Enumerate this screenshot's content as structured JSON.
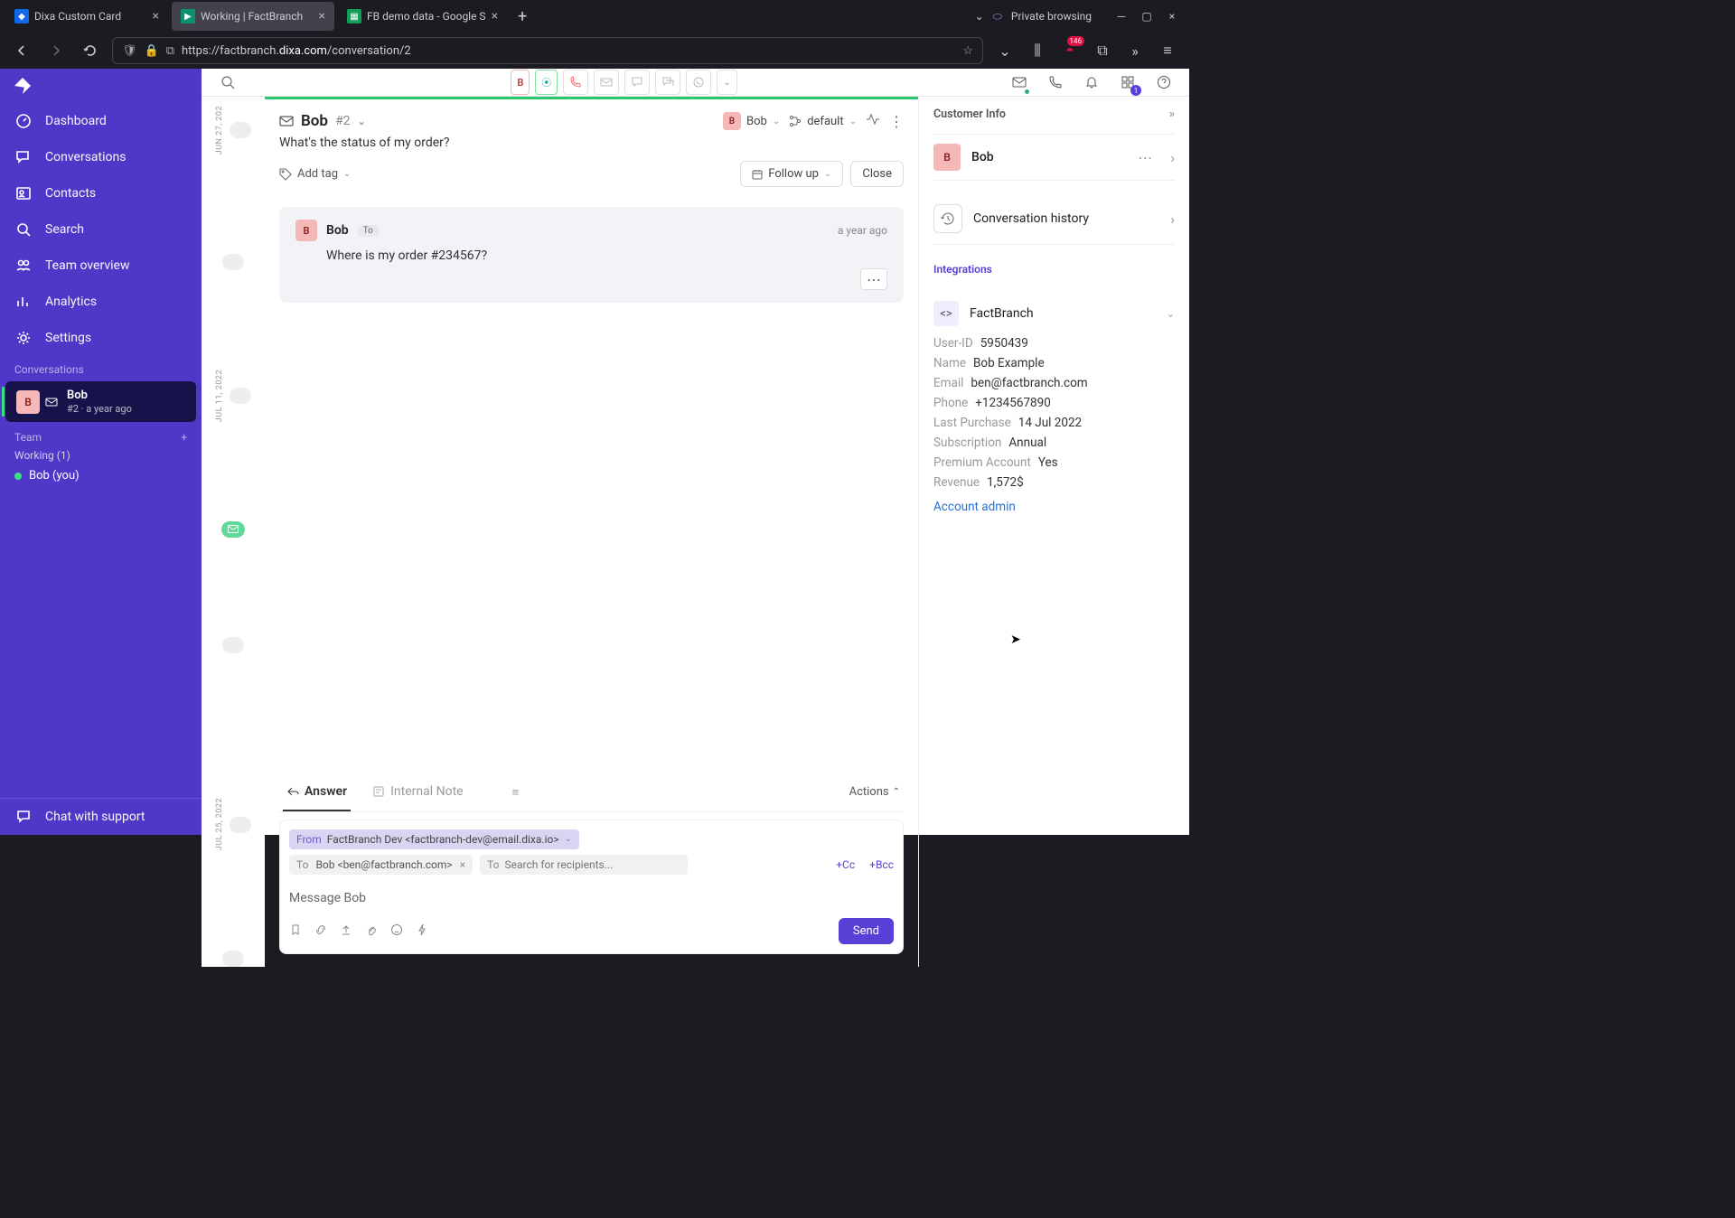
{
  "browser": {
    "tabs": [
      {
        "title": "Dixa Custom Card",
        "active": false
      },
      {
        "title": "Working | FactBranch",
        "active": true
      },
      {
        "title": "FB demo data - Google S",
        "active": false
      }
    ],
    "url_prefix": "https://factbranch.",
    "url_domain": "dixa.com",
    "url_path": "/conversation/2",
    "private_label": "Private browsing",
    "ext_badge": "146"
  },
  "sidebar": {
    "nav": [
      {
        "label": "Dashboard"
      },
      {
        "label": "Conversations"
      },
      {
        "label": "Contacts"
      },
      {
        "label": "Search"
      },
      {
        "label": "Team overview"
      },
      {
        "label": "Analytics"
      },
      {
        "label": "Settings"
      }
    ],
    "conversations_label": "Conversations",
    "conv": {
      "initial": "B",
      "name": "Bob",
      "sub": "#2 · a year ago"
    },
    "team_label": "Team",
    "team_working": "Working (1)",
    "team_member": "Bob (you)",
    "chat_support": "Chat with support"
  },
  "topbar": {
    "notif_count": "1"
  },
  "conversation": {
    "title": "Bob",
    "id": "#2",
    "subject": "What's the status of my order?",
    "add_tag": "Add tag",
    "assignee": "Bob",
    "queue": "default",
    "follow_up": "Follow up",
    "close": "Close",
    "message": {
      "initial": "B",
      "name": "Bob",
      "to": "To",
      "time": "a year ago",
      "body": "Where is my order #234567?"
    },
    "timeline": [
      "JUN 27, 202",
      "JUL 11, 2022",
      "JUL 25, 2022"
    ]
  },
  "composer": {
    "tabs": {
      "answer": "Answer",
      "note": "Internal Note"
    },
    "actions": "Actions",
    "from_label": "From",
    "from_value": "FactBranch Dev <factbranch-dev@email.dixa.io>",
    "to_label": "To",
    "to_value": "Bob <ben@factbranch.com>",
    "to_placeholder": "Search for recipients...",
    "cc": "+Cc",
    "bcc": "+Bcc",
    "placeholder": "Message Bob",
    "send": "Send"
  },
  "rightPanel": {
    "title": "Customer Info",
    "customer_initial": "B",
    "customer_name": "Bob",
    "history": "Conversation history",
    "integrations": "Integrations",
    "factbranch": "FactBranch",
    "fields": [
      {
        "k": "User-ID",
        "v": "5950439"
      },
      {
        "k": "Name",
        "v": "Bob Example"
      },
      {
        "k": "Email",
        "v": "ben@factbranch.com"
      },
      {
        "k": "Phone",
        "v": "+1234567890"
      },
      {
        "k": "Last Purchase",
        "v": "14 Jul 2022"
      },
      {
        "k": "Subscription",
        "v": "Annual"
      },
      {
        "k": "Premium Account",
        "v": "Yes"
      },
      {
        "k": "Revenue",
        "v": "1,572$"
      }
    ],
    "link": "Account admin"
  }
}
